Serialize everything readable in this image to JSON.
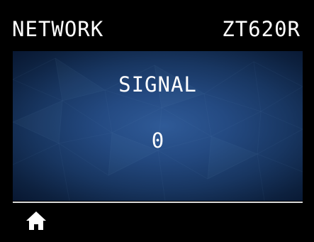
{
  "header": {
    "title": "NETWORK",
    "model": "ZT620R"
  },
  "main": {
    "label": "SIGNAL",
    "value": "0"
  },
  "footer": {
    "home_icon": "home-icon"
  },
  "colors": {
    "background": "#000000",
    "panel_center": "#2f5a97",
    "panel_edge": "#081731",
    "text": "#ffffff",
    "divider": "#d8d8d8"
  }
}
